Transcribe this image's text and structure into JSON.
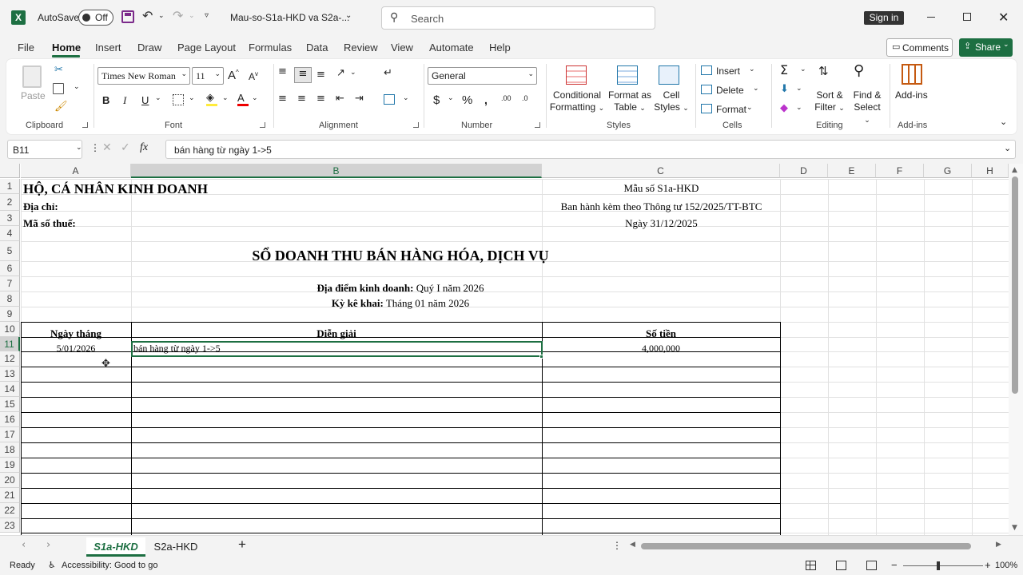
{
  "titlebar": {
    "autosave_label": "AutoSave",
    "autosave_state": "Off",
    "file_name": "Mau-so-S1a-HKD va S2a-...",
    "search_placeholder": "Search",
    "signin_label": "Sign in"
  },
  "menu": {
    "tabs": [
      "File",
      "Home",
      "Insert",
      "Draw",
      "Page Layout",
      "Formulas",
      "Data",
      "Review",
      "View",
      "Automate",
      "Help"
    ],
    "comments_label": "Comments",
    "share_label": "Share"
  },
  "ribbon": {
    "clipboard": {
      "paste": "Paste",
      "group": "Clipboard"
    },
    "font": {
      "name": "Times New Roman",
      "size": "11",
      "group": "Font",
      "bold": "B",
      "italic": "I",
      "underline": "U"
    },
    "alignment": {
      "group": "Alignment"
    },
    "number": {
      "format": "General",
      "group": "Number",
      "currency": "$",
      "percent": "%"
    },
    "styles": {
      "conditional": [
        "Conditional",
        "Formatting"
      ],
      "format_table": [
        "Format as",
        "Table"
      ],
      "cell_styles": [
        "Cell",
        "Styles"
      ],
      "group": "Styles"
    },
    "cells": {
      "insert": "Insert",
      "delete": "Delete",
      "format": "Format",
      "group": "Cells"
    },
    "editing": {
      "sort": [
        "Sort &",
        "Filter"
      ],
      "find": [
        "Find &",
        "Select"
      ],
      "group": "Editing"
    },
    "addins": {
      "label": "Add-ins",
      "group": "Add-ins"
    }
  },
  "formula": {
    "namebox": "B11",
    "fx": "fx",
    "content": "bán hàng từ ngày 1->5"
  },
  "columns": [
    "A",
    "B",
    "C",
    "D",
    "E",
    "F",
    "G",
    "H"
  ],
  "rows": [
    "1",
    "2",
    "3",
    "4",
    "5",
    "6",
    "7",
    "8",
    "9",
    "10",
    "11",
    "12",
    "13",
    "14",
    "15",
    "16",
    "17",
    "18",
    "19",
    "20",
    "21",
    "22",
    "23"
  ],
  "sheet": {
    "r1a": "HỘ, CÁ NHÂN KINH DOANH",
    "r1c": "Mẫu số S1a-HKD",
    "r2a": "Địa chỉ:",
    "r2c": "Ban hành kèm theo Thông tư 152/2025/TT-BTC",
    "r3a": "Mã số thuế:",
    "r3c": "Ngày 31/12/2025",
    "r5": "SỔ DOANH THU BÁN HÀNG HÓA, DỊCH VỤ",
    "r7_label": "Địa điểm kinh doanh:",
    "r7_value": "Quý I năm 2026",
    "r8_label": "Kỳ kê khai:",
    "r8_value": "Tháng 01 năm 2026",
    "h_date": "Ngày tháng",
    "h_desc": "Diễn giải",
    "h_amount": "Số tiền",
    "d_date": "5/01/2026",
    "d_desc": "bán hàng từ ngày 1->5",
    "d_amount": "4,000,000"
  },
  "tabs": {
    "active": "S1a-HKD",
    "other": "S2a-HKD",
    "add": "+"
  },
  "status": {
    "ready": "Ready",
    "accessibility": "Accessibility: Good to go",
    "zoom": "100%"
  }
}
